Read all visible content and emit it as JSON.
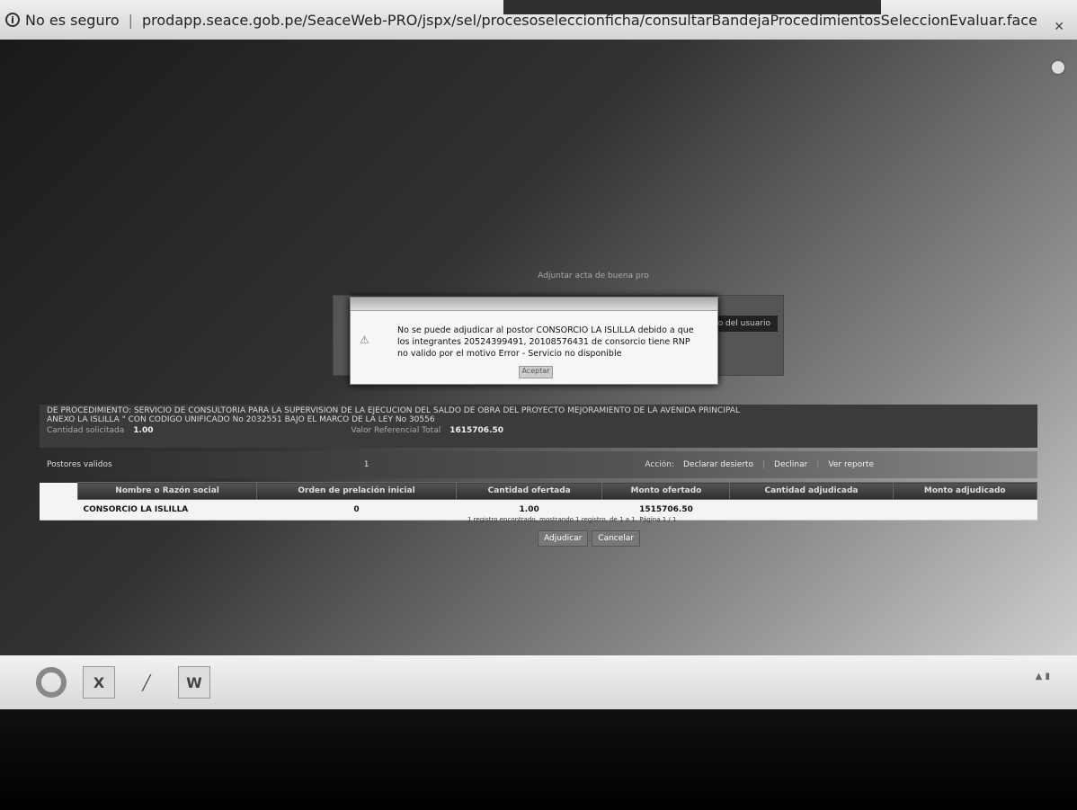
{
  "browser": {
    "security_label": "No es seguro",
    "url": "prodapp.seace.gob.pe/SeaceWeb-PRO/jspx/sel/procesoseleccionficha/consultarBandejaProcedimientosSeleccionEvaluar.face"
  },
  "background_panel": {
    "title": "Adjuntar acta de buena pro",
    "dark_button_label": "o del usuario"
  },
  "modal": {
    "message": "No se puede adjudicar al postor CONSORCIO LA ISLILLA debido a que los integrantes 20524399491, 20108576431 de consorcio tiene RNP no valido por el motivo Error - Servicio no disponible",
    "ok_label": "Aceptar"
  },
  "process": {
    "line1": "DE PROCEDIMIENTO: SERVICIO DE CONSULTORIA PARA LA SUPERVISION DE LA EJECUCION DEL SALDO DE OBRA DEL PROYECTO MEJORAMIENTO DE LA AVENIDA PRINCIPAL",
    "line2": "ANEXO LA ISLILLA \" CON CODIGO UNIFICADO No 2032551 BAJO EL MARCO DE LA LEY No 30556",
    "cantidad_label": "Cantidad solicitada",
    "cantidad_value": "1.00",
    "valor_label": "Valor Referencial Total",
    "valor_value": "1615706.50"
  },
  "action_bar": {
    "label": "Postores validos",
    "count": "1",
    "accion_label": "Acción:",
    "actions": [
      "Declarar desierto",
      "Declinar",
      "Ver reporte"
    ]
  },
  "table": {
    "headers": [
      "Nombre o Razón social",
      "Orden de prelación inicial",
      "Cantidad ofertada",
      "Monto ofertado",
      "Cantidad adjudicada",
      "Monto adjudicado"
    ],
    "rows": [
      {
        "name": "CONSORCIO LA ISLILLA",
        "orden": "0",
        "cantidad": "1.00",
        "monto": "1515706.50",
        "cant_adj": "",
        "monto_adj": ""
      }
    ],
    "pager": "1 registro encontrado, mostrando 1 registro, de 1 a 1. Página 1 / 1",
    "buttons": [
      "Adjudicar",
      "Cancelar"
    ]
  },
  "taskbar": {
    "icons": [
      "chrome-icon",
      "excel-icon",
      "paint-icon",
      "word-icon"
    ]
  }
}
